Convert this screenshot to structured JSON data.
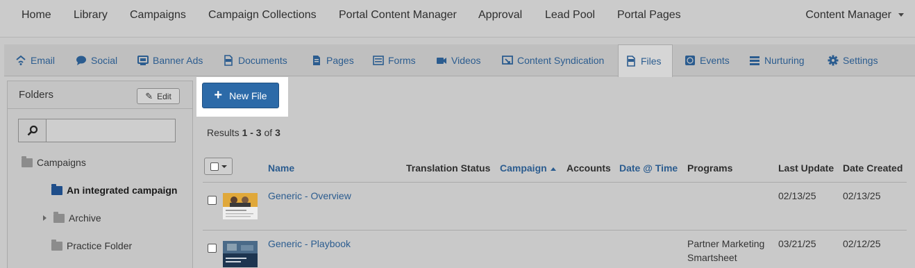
{
  "topnav": {
    "items": [
      "Home",
      "Library",
      "Campaigns",
      "Campaign Collections",
      "Portal Content Manager",
      "Approval",
      "Lead Pool",
      "Portal Pages"
    ],
    "user_menu": "Content Manager"
  },
  "tabs": [
    {
      "label": "Email",
      "icon": "wifi-home-icon"
    },
    {
      "label": "Social",
      "icon": "speech-bubble-icon"
    },
    {
      "label": "Banner Ads",
      "icon": "banner-icon"
    },
    {
      "label": "Documents",
      "icon": "pdf-icon"
    },
    {
      "label": "Pages",
      "icon": "page-icon"
    },
    {
      "label": "Forms",
      "icon": "form-icon"
    },
    {
      "label": "Videos",
      "icon": "video-camera-icon"
    },
    {
      "label": "Content Syndication",
      "icon": "syndication-icon"
    },
    {
      "label": "Files",
      "icon": "doc-file-icon",
      "active": true
    },
    {
      "label": "Events",
      "icon": "globe-icon"
    },
    {
      "label": "Nurturing",
      "icon": "nurturing-icon"
    },
    {
      "label": "Settings",
      "icon": "gear-icon"
    }
  ],
  "sidebar": {
    "title": "Folders",
    "edit_label": "Edit",
    "search_placeholder": "",
    "tree": [
      {
        "label": "Campaigns"
      },
      {
        "label": "An integrated campaign",
        "selected": true
      },
      {
        "label": "Archive",
        "expandable": true
      },
      {
        "label": "Practice Folder"
      }
    ]
  },
  "main": {
    "new_button": "New File",
    "results": {
      "prefix": "Results ",
      "range": "1 - 3",
      "of": " of ",
      "total": "3"
    },
    "columns": [
      "Name",
      "Translation Status",
      "Campaign",
      "Accounts",
      "Date @ Time",
      "Programs",
      "Last Update",
      "Date Created"
    ],
    "rows": [
      {
        "name": "Generic - Overview",
        "programs_line1": "",
        "programs_line2": "",
        "last_update": "02/13/25",
        "date_created": "02/13/25"
      },
      {
        "name": "Generic - Playbook",
        "programs_line1": "Partner Marketing",
        "programs_line2": "Smartsheet",
        "last_update": "03/21/25",
        "date_created": "02/12/25"
      }
    ]
  },
  "colors": {
    "link": "#2b5c8f",
    "button": "#2c6aa8",
    "folder_selected": "#1f4e8a"
  }
}
